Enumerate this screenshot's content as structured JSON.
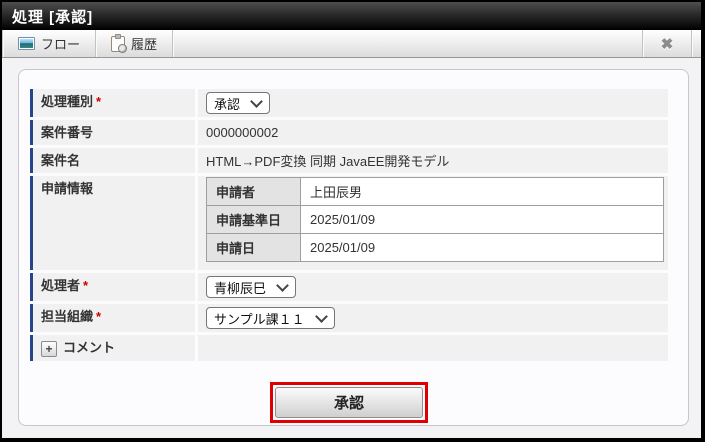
{
  "titlebar": {
    "title": "処理 [承認]"
  },
  "toolbar": {
    "flow_label": "フロー",
    "history_label": "履歴",
    "close_glyph": "✖"
  },
  "form": {
    "rows": {
      "process_type": {
        "label": "処理種別",
        "required_mark": "*",
        "value": "承認"
      },
      "case_number": {
        "label": "案件番号",
        "value": "0000000002"
      },
      "case_name": {
        "label": "案件名",
        "value": "HTML→PDF変換 同期 JavaEE開発モデル"
      },
      "application_info": {
        "label": "申請情報",
        "table": {
          "applicant": {
            "header": "申請者",
            "value": "上田辰男"
          },
          "base_date": {
            "header": "申請基準日",
            "value": "2025/01/09"
          },
          "apply_date": {
            "header": "申請日",
            "value": "2025/01/09"
          }
        }
      },
      "processor": {
        "label": "処理者",
        "required_mark": "*",
        "value": "青柳辰巳"
      },
      "organization": {
        "label": "担当組織",
        "required_mark": "*",
        "value": "サンプル課１１"
      },
      "comment": {
        "label": "コメント",
        "expand_glyph": "+"
      }
    }
  },
  "actions": {
    "approve_label": "承認"
  },
  "colors": {
    "accent_bar": "#26458c",
    "required": "#cc0000",
    "highlight_border": "#e10000",
    "titlebar_bg": "#000000"
  }
}
